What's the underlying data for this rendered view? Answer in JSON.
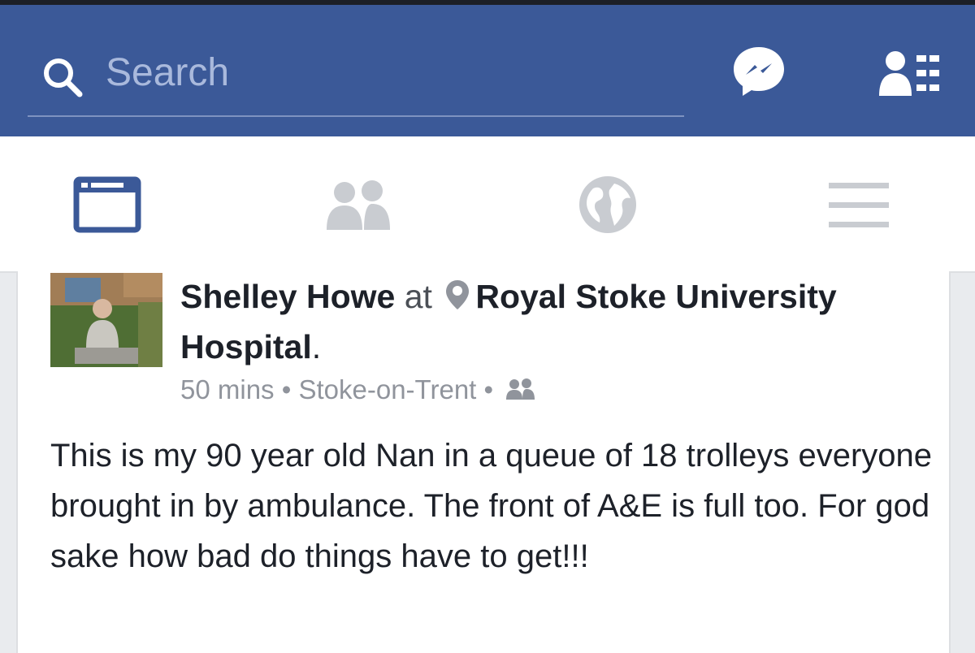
{
  "header": {
    "search_placeholder": "Search",
    "bg_color": "#3b5998"
  },
  "nav": {
    "items": [
      "news-feed",
      "friends",
      "notifications",
      "menu"
    ],
    "active": "news-feed",
    "active_color": "#3b5998",
    "inactive_color": "#c9ccd1"
  },
  "post": {
    "author": "Shelley Howe",
    "at": "at",
    "place": "Royal Stoke University Hospital",
    "place_suffix": ".",
    "time": "50 mins",
    "location": "Stoke-on-Trent",
    "separator": "•",
    "text": "This is my 90 year old Nan in a queue of 18 trolleys everyone brought in by ambulance. The front of A&E is full too. For god sake how bad do things have to get!!!"
  }
}
